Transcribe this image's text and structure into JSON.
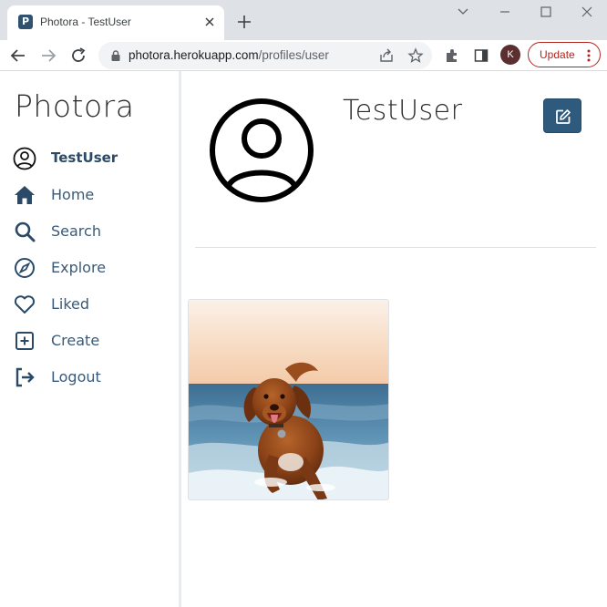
{
  "browser": {
    "tab_title": "Photora - TestUser",
    "favicon_letter": "P",
    "url_host": "photora.herokuapp.com",
    "url_path": "/profiles/user",
    "profile_initial": "K",
    "update_label": "Update"
  },
  "sidebar": {
    "brand": "Photora",
    "items": [
      {
        "label": "TestUser",
        "icon": "user-circle-icon"
      },
      {
        "label": "Home",
        "icon": "home-icon"
      },
      {
        "label": "Search",
        "icon": "search-icon"
      },
      {
        "label": "Explore",
        "icon": "compass-icon"
      },
      {
        "label": "Liked",
        "icon": "heart-icon"
      },
      {
        "label": "Create",
        "icon": "plus-square-icon"
      },
      {
        "label": "Logout",
        "icon": "logout-icon"
      }
    ]
  },
  "profile": {
    "username": "TestUser",
    "edit_icon": "edit-icon"
  },
  "posts": [
    {
      "subject": "dog running in ocean waves"
    }
  ],
  "colors": {
    "accent": "#2e5a7e",
    "nav_text": "#3a5a78",
    "update_red": "#b3261e"
  }
}
